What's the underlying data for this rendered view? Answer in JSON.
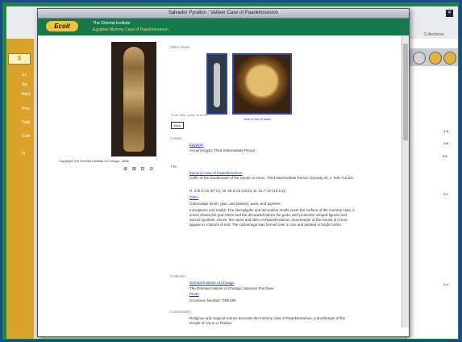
{
  "window": {
    "title": "Salvador Pyrallon : Vatteer Case of Paankhoseston"
  },
  "banner": {
    "logo": "Ecoit",
    "line1": "The Oriental Institute",
    "line2": "Egyptian Mummy Case of Paankhenamun"
  },
  "left_panel": {
    "caption": "Copyright The Oriental Institute of Chicago, 2008",
    "tool_icons": "⊕ ⊞ ⊟ ⊖"
  },
  "other_views": {
    "label": "Other Views",
    "left_caption": "Front view, photo of mum",
    "right_caption": "view of top of head"
  },
  "button_label": "back",
  "sections": {
    "creator_label": "Creator",
    "creator_link": "Egyptian",
    "creator_text": "Ancient Egypt, Third Intermediate Period",
    "title_label": "Title",
    "title_link": "Mummy Case of Paankhenamun",
    "title_text": "Coffin of the Doorkeeper of the House of Amun. Third Intermediate Period, Dynasty 22, c. 945-715 BC",
    "dims": "H. 175.2 cm (67 in), W. 48.3 cm (19 in), D. 31.7 cm (12.5 in)",
    "other_link": "Other",
    "materials": "Cartonnage (linen, glue, and plaster), paint, and pigment",
    "desc": "Inscriptions and marks: The hieroglyphs and decorative motifs cover the surface of the mummy case. A scene shows the god Osiris and the deceased before the gods, with protective winged figures and sacred symbols. Above, the name and titles of Paankhenamun, Doorkeeper of the House of Amun, appear in columns of text. The cartonnage was formed over a core and painted in bright colors.",
    "owner_label": "Collection",
    "owner_link": "Oriental Institute of Chicago",
    "owner_text": "The Oriental Institute of Chicago, Museum Purchase",
    "credit_link": "Photo",
    "accession": "Accession Number: OIM 258",
    "comments_label": "Commentary",
    "comments": "Religious and magical scenes decorate the mummy case of Paankhenamun, a doorkeeper of the temple of Amun in Thebes."
  },
  "desktop": {
    "right_toolbar_label": "Collections",
    "side_links": [
      "Ex",
      "Sty",
      "Navi",
      "Pres",
      "Help",
      "Cont",
      "Fi"
    ],
    "right_values": [
      "-1.8",
      "-3.8",
      "3.8",
      "-3.7",
      "-3.4"
    ]
  }
}
